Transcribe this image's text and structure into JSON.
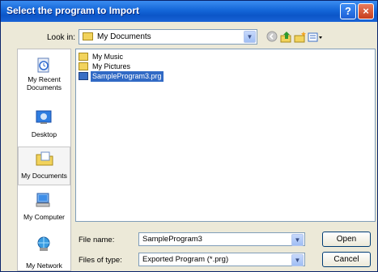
{
  "window": {
    "title": "Select the program to Import",
    "help_label": "?",
    "close_label": "×"
  },
  "lookin": {
    "label": "Look in:",
    "value": "My Documents"
  },
  "toolbar": {
    "icons": [
      "back-icon",
      "up-folder-icon",
      "new-folder-icon",
      "views-menu-icon"
    ]
  },
  "places": [
    {
      "label": "My Recent Documents",
      "icon": "recent-documents-icon"
    },
    {
      "label": "Desktop",
      "icon": "desktop-icon"
    },
    {
      "label": "My Documents",
      "icon": "my-documents-icon",
      "selected": true
    },
    {
      "label": "My Computer",
      "icon": "my-computer-icon"
    },
    {
      "label": "My Network",
      "icon": "my-network-icon"
    }
  ],
  "files": [
    {
      "name": "My Music",
      "type": "folder"
    },
    {
      "name": "My Pictures",
      "type": "folder"
    },
    {
      "name": "SampleProgram3.prg",
      "type": "file",
      "selected": true
    }
  ],
  "filename": {
    "label": "File name:",
    "value": "SampleProgram3"
  },
  "filetype": {
    "label": "Files of type:",
    "value": "Exported Program (*.prg)"
  },
  "buttons": {
    "open": "Open",
    "cancel": "Cancel"
  }
}
